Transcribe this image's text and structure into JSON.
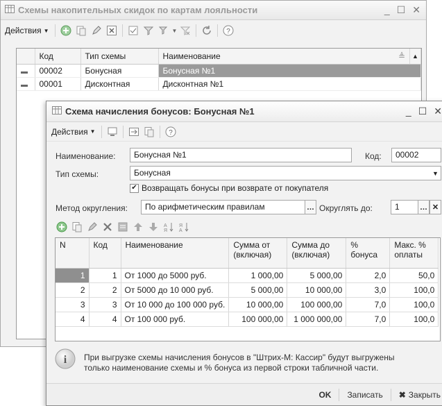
{
  "win1": {
    "title": "Схемы накопительных скидок по картам лояльности",
    "actions_label": "Действия",
    "columns": [
      "Код",
      "Тип схемы",
      "Наименование"
    ],
    "rows": [
      {
        "code": "00002",
        "type": "Бонусная",
        "name": "Бонусная №1"
      },
      {
        "code": "00001",
        "type": "Дисконтная",
        "name": "Дисконтная №1"
      }
    ]
  },
  "win2": {
    "title": "Схема начисления бонусов: Бонусная №1",
    "actions_label": "Действия",
    "name_label": "Наименование:",
    "name_value": "Бонусная №1",
    "code_label": "Код:",
    "code_value": "00002",
    "scheme_type_label": "Тип схемы:",
    "scheme_type_value": "Бонусная",
    "return_bonus_label": "Возвращать бонусы при возврате от покупателя",
    "return_bonus_checked": true,
    "rounding_label": "Метод округления:",
    "rounding_value": "По арифметическим правилам",
    "round_to_label": "Округлять до:",
    "round_to_value": "1",
    "columns": [
      "N",
      "Код",
      "Наименование",
      "Сумма от (включая)",
      "Сумма до (включая)",
      "% бонуса",
      "Макс. % оплаты"
    ],
    "rows": [
      {
        "n": "1",
        "code": "1",
        "name": "От 1000 до 5000 руб.",
        "from": "1 000,00",
        "to": "5 000,00",
        "bonus": "2,0",
        "max": "50,0"
      },
      {
        "n": "2",
        "code": "2",
        "name": "От 5000 до 10 000 руб.",
        "from": "5 000,00",
        "to": "10 000,00",
        "bonus": "3,0",
        "max": "100,0"
      },
      {
        "n": "3",
        "code": "3",
        "name": "От 10 000 до 100 000 руб.",
        "from": "10 000,00",
        "to": "100 000,00",
        "bonus": "7,0",
        "max": "100,0"
      },
      {
        "n": "4",
        "code": "4",
        "name": "От 100 000 руб.",
        "from": "100 000,00",
        "to": "1 000 000,00",
        "bonus": "7,0",
        "max": "100,0"
      }
    ],
    "info_line1": "При выгрузке схемы начисления бонусов в \"Штрих-М: Кассир\" будут выгружены",
    "info_line2": "только наименование схемы и % бонуса из первой строки табличной части.",
    "ok_label": "OK",
    "save_label": "Записать",
    "close_label": "Закрыть"
  },
  "colors": {
    "selected_row": "#9a9a9a",
    "green_icon": "#4aa84a",
    "window_bg": "#f2f2f2"
  }
}
